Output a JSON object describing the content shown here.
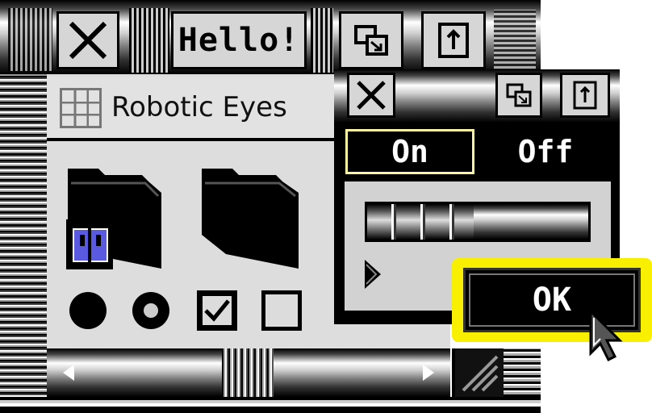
{
  "window_main": {
    "title_label": "Hello!",
    "icons": {
      "close": "close-icon",
      "zoom": "zoom-icon",
      "raise": "raise-icon"
    }
  },
  "robotic_panel": {
    "header_label": "Robotic Eyes"
  },
  "toggle_window": {
    "on_label": "On",
    "off_label": "Off",
    "ok_label": "OK"
  },
  "progress": {
    "value_percent": 48
  },
  "checkboxes": [
    {
      "checked": true
    },
    {
      "checked": false
    }
  ],
  "radios": [
    {
      "selected": false
    },
    {
      "selected": true
    }
  ],
  "colors": {
    "accent_yellow": "#f8f000",
    "selection_yellow": "#fff4a0",
    "finder_blue": "#5a5ae0"
  }
}
